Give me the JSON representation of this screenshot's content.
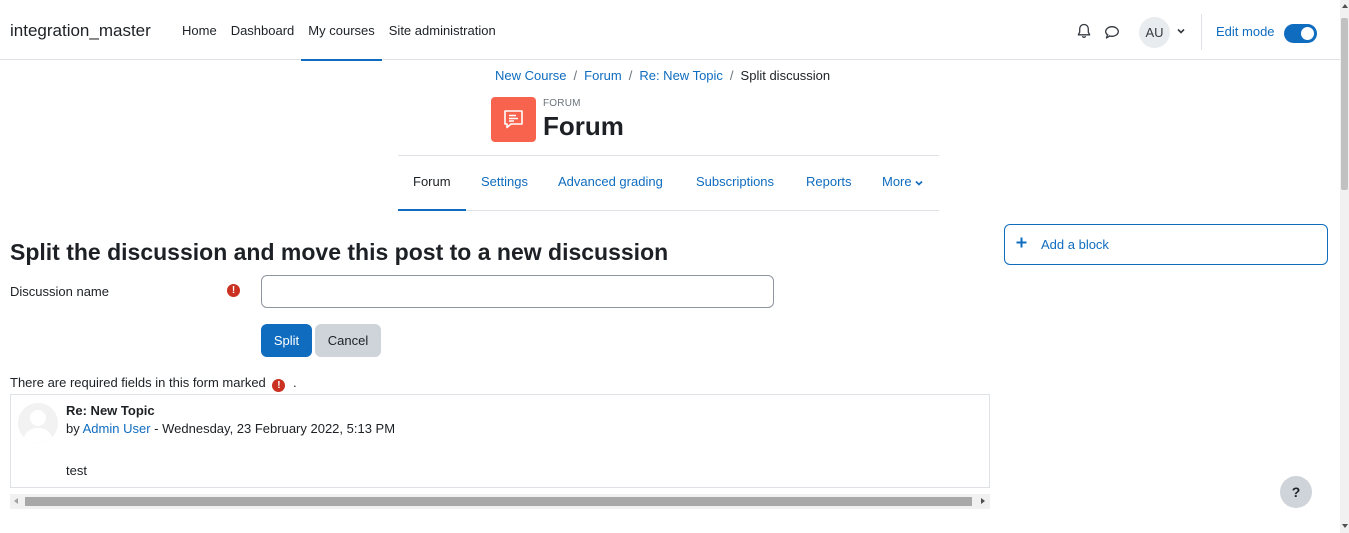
{
  "navbar": {
    "brand": "integration_master",
    "items": [
      {
        "label": "Home"
      },
      {
        "label": "Dashboard"
      },
      {
        "label": "My courses"
      },
      {
        "label": "Site administration"
      }
    ],
    "active_item": "My courses",
    "user_initials": "AU",
    "edit_mode_label": "Edit mode",
    "edit_mode_on": true
  },
  "breadcrumb": {
    "items": [
      "New Course",
      "Forum",
      "Re: New Topic"
    ],
    "separator": "/",
    "current": "Split discussion"
  },
  "header": {
    "activity_type": "FORUM",
    "title": "Forum",
    "icon_color": "#f7634d"
  },
  "secondary_nav": {
    "tabs": [
      {
        "label": "Forum"
      },
      {
        "label": "Settings"
      },
      {
        "label": "Advanced grading"
      },
      {
        "label": "Subscriptions"
      },
      {
        "label": "Reports"
      },
      {
        "label": "More"
      }
    ],
    "active_tab": "Forum"
  },
  "form": {
    "heading": "Split the discussion and move this post to a new discussion",
    "discussion_name_label": "Discussion name",
    "discussion_name_value": "",
    "submit_label": "Split",
    "cancel_label": "Cancel",
    "required_note": "There are required fields in this form marked",
    "required_note_end": "."
  },
  "post": {
    "subject": "Re: New Topic",
    "by_prefix": "by",
    "author": "Admin User",
    "date_text": " - Wednesday, 23 February 2022, 5:13 PM",
    "body": "test"
  },
  "blocks": {
    "add_block_label": "Add a block"
  },
  "help": {
    "label": "?"
  },
  "colors": {
    "accent": "#0f6cbf",
    "required": "#ca3120",
    "forum_icon": "#f7634d"
  }
}
